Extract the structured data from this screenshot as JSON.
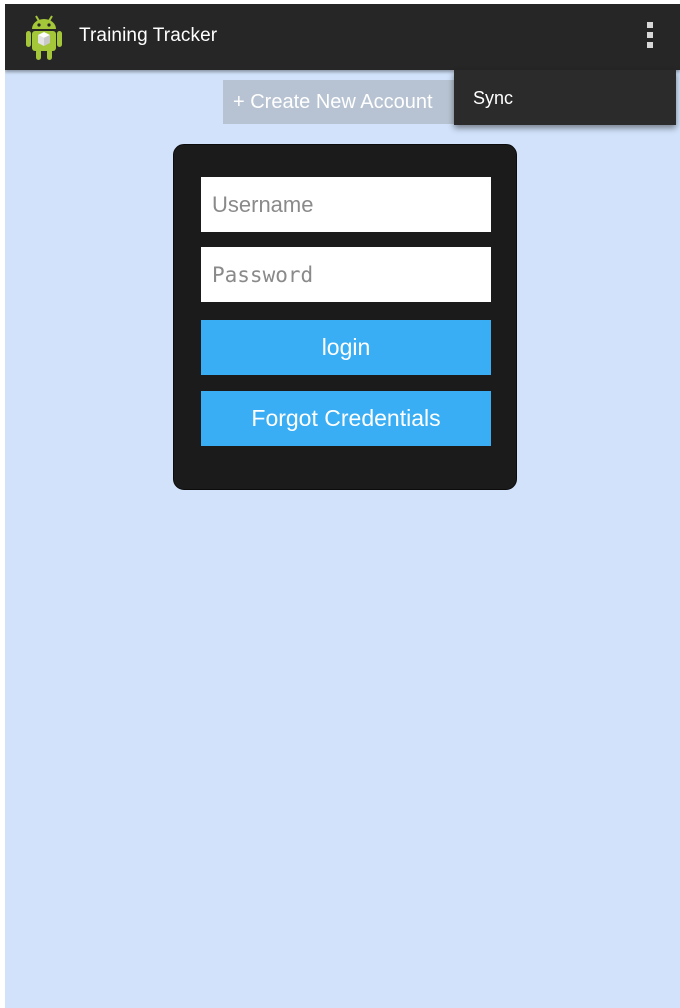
{
  "app": {
    "title": "Training Tracker",
    "icon": "android-app-icon"
  },
  "action_bar": {
    "overflow_icon": "overflow-menu-icon"
  },
  "overflow_menu": {
    "items": [
      {
        "label": "Sync"
      }
    ]
  },
  "create_account": {
    "label": "+ Create New Account"
  },
  "login_form": {
    "username_placeholder": "Username",
    "username_value": "",
    "password_placeholder": "Password",
    "password_value": "",
    "login_label": "login",
    "forgot_label": "Forgot Credentials"
  },
  "colors": {
    "action_bar": "#262626",
    "background": "#d1e2fa",
    "card": "#1b1b1b",
    "button_blue": "#3aaef4",
    "create_button": "#b7c3d2"
  }
}
